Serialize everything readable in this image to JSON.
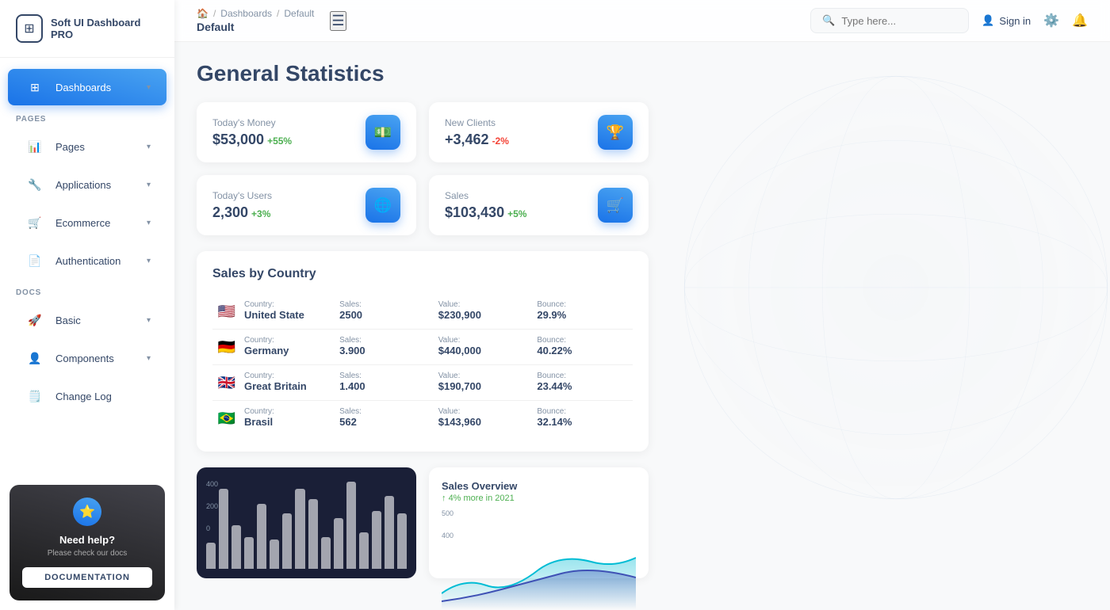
{
  "app": {
    "name": "Soft UI Dashboard PRO"
  },
  "sidebar": {
    "sections": [
      {
        "label": "PAGES",
        "items": [
          {
            "id": "dashboards",
            "label": "Dashboards",
            "icon": "⊞",
            "active": true,
            "hasChevron": true
          },
          {
            "id": "pages",
            "label": "Pages",
            "icon": "📊",
            "active": false,
            "hasChevron": true
          },
          {
            "id": "applications",
            "label": "Applications",
            "icon": "🔧",
            "active": false,
            "hasChevron": true
          },
          {
            "id": "ecommerce",
            "label": "Ecommerce",
            "icon": "🛒",
            "active": false,
            "hasChevron": true
          },
          {
            "id": "authentication",
            "label": "Authentication",
            "icon": "📄",
            "active": false,
            "hasChevron": true
          }
        ]
      },
      {
        "label": "DOCS",
        "items": [
          {
            "id": "basic",
            "label": "Basic",
            "icon": "🚀",
            "active": false,
            "hasChevron": true
          },
          {
            "id": "components",
            "label": "Components",
            "icon": "👤",
            "active": false,
            "hasChevron": true
          },
          {
            "id": "changelog",
            "label": "Change Log",
            "icon": "🗒️",
            "active": false,
            "hasChevron": false
          }
        ]
      }
    ],
    "help": {
      "title": "Need help?",
      "subtitle": "Please check our docs",
      "buttonLabel": "DOCUMENTATION"
    }
  },
  "topbar": {
    "breadcrumb": {
      "home": "🏠",
      "separator": "/",
      "parent": "Dashboards",
      "current": "Default"
    },
    "search": {
      "placeholder": "Type here..."
    },
    "actions": {
      "signin": "Sign in"
    }
  },
  "page": {
    "title": "General Statistics"
  },
  "stats": [
    {
      "label": "Today's Money",
      "value": "$53,000",
      "change": "+55%",
      "changeType": "pos",
      "icon": "💵"
    },
    {
      "label": "New Clients",
      "value": "+3,462",
      "change": "-2%",
      "changeType": "neg",
      "icon": "🏆"
    },
    {
      "label": "Today's Users",
      "value": "2,300",
      "change": "+3%",
      "changeType": "pos",
      "icon": "🌐"
    },
    {
      "label": "Sales",
      "value": "$103,430",
      "change": "+5%",
      "changeType": "pos",
      "icon": "🛒"
    }
  ],
  "salesByCountry": {
    "title": "Sales by Country",
    "columns": [
      "Country:",
      "Sales:",
      "Value:",
      "Bounce:"
    ],
    "rows": [
      {
        "flag": "🇺🇸",
        "country": "United State",
        "sales": "2500",
        "value": "$230,900",
        "bounce": "29.9%"
      },
      {
        "flag": "🇩🇪",
        "country": "Germany",
        "sales": "3.900",
        "value": "$440,000",
        "bounce": "40.22%"
      },
      {
        "flag": "🇬🇧",
        "country": "Great Britain",
        "sales": "1.400",
        "value": "$190,700",
        "bounce": "23.44%"
      },
      {
        "flag": "🇧🇷",
        "country": "Brasil",
        "sales": "562",
        "value": "$143,960",
        "bounce": "32.14%"
      }
    ]
  },
  "barChart": {
    "yLabels": [
      "400",
      "200",
      "0"
    ],
    "bars": [
      18,
      55,
      30,
      22,
      45,
      20,
      38,
      55,
      48,
      22,
      35,
      60,
      25,
      40,
      50,
      38
    ]
  },
  "salesOverview": {
    "title": "Sales Overview",
    "subtitle": "4% more in 2021",
    "yLabels": [
      "500",
      "400"
    ]
  }
}
